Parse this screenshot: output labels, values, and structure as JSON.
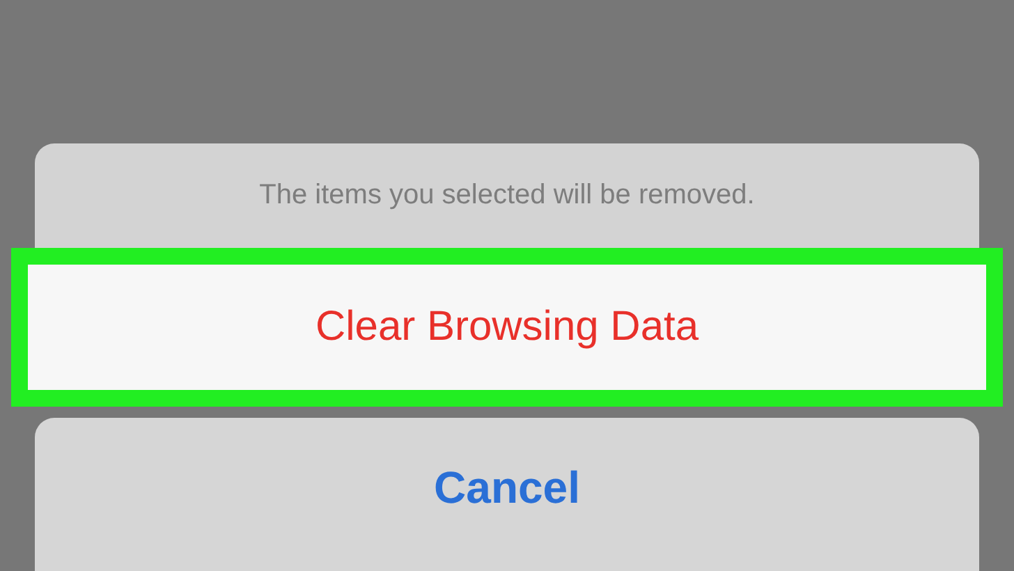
{
  "action_sheet": {
    "message": "The items you selected will be removed.",
    "actions": [
      {
        "label": "Clear Browsing Data",
        "kind": "destructive",
        "highlighted": true
      }
    ],
    "cancel": {
      "label": "Cancel"
    }
  }
}
